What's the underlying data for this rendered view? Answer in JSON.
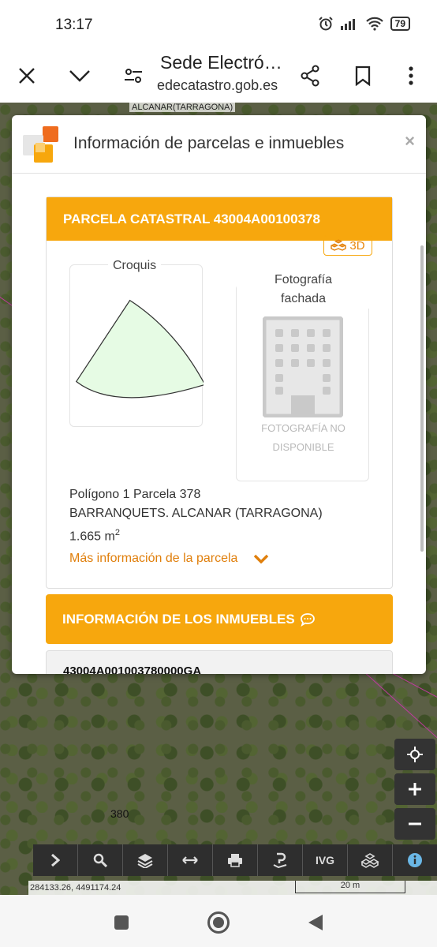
{
  "status_bar": {
    "time": "13:17",
    "battery": "79"
  },
  "browser": {
    "title": "Sede Electró…",
    "url": "edecatastro.gob.es"
  },
  "map": {
    "top_label": "ALCANAR(TARRAGONA)",
    "parcel_label": "380",
    "coords": "284133.26, 4491174.24",
    "scale": "20 m",
    "toolbar_ivg": "IVG"
  },
  "modal": {
    "title": "Información de parcelas e inmuebles",
    "close": "×",
    "parcel": {
      "heading": "PARCELA CATASTRAL 43004A00100378",
      "btn_3d": "3D",
      "croquis": "Croquis",
      "foto_line1": "Fotografía",
      "foto_line2": "fachada",
      "foto_na_line1": "FOTOGRAFÍA NO",
      "foto_na_line2": "DISPONIBLE",
      "line1": "Polígono 1 Parcela 378",
      "line2": "BARRANQUETS. ALCANAR (TARRAGONA)",
      "area": "1.665 m",
      "area_sup": "2",
      "more_info": "Más información de la parcela"
    },
    "inmuebles": {
      "heading": "INFORMACIÓN DE LOS INMUEBLES",
      "first_ref": "43004A001003780000GA"
    }
  },
  "colors": {
    "accent": "#f7a70d",
    "link": "#e07f0c"
  }
}
